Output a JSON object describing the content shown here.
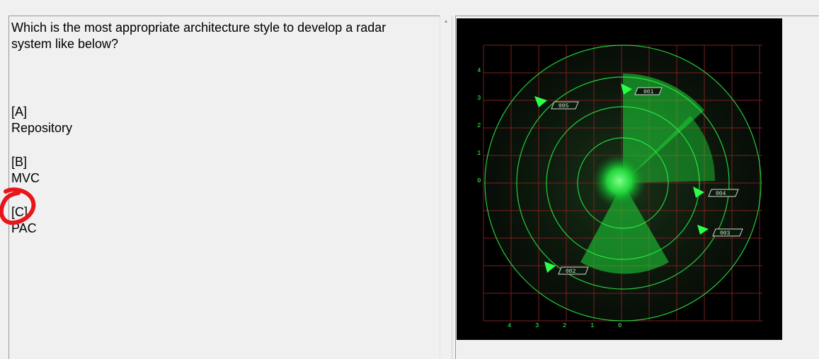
{
  "question": {
    "line1": "Which is the most appropriate architecture style to develop a radar",
    "line2": "system like below?"
  },
  "options": [
    {
      "letter": "[A]",
      "text": "Repository"
    },
    {
      "letter": "[B]",
      "text": "MVC"
    },
    {
      "letter": "[C]",
      "text": "PAC"
    }
  ],
  "radar": {
    "targets": [
      "001",
      "005",
      "004",
      "003",
      "002"
    ],
    "y_ticks": [
      "4",
      "3",
      "2",
      "1",
      "0"
    ],
    "x_ticks": [
      "4",
      "3",
      "2",
      "1",
      "0"
    ]
  },
  "colors": {
    "radar_green": "#2bff4a",
    "grid_red": "#7a1f1f",
    "annotation_red": "#e8151b"
  }
}
